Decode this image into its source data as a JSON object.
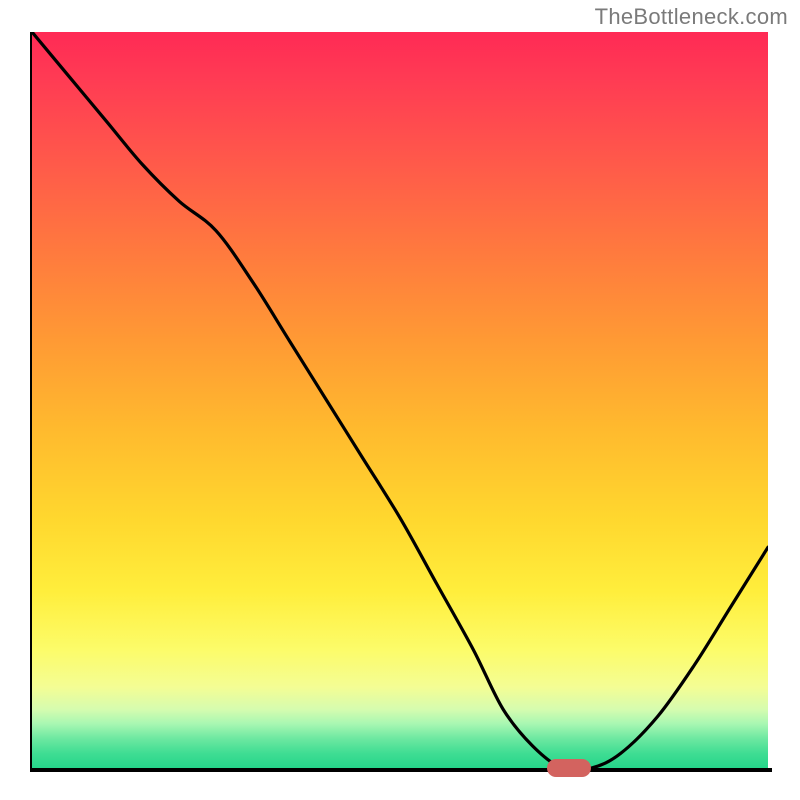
{
  "branding": {
    "watermark": "TheBottleneck.com"
  },
  "chart_data": {
    "type": "line",
    "title": "",
    "xlabel": "",
    "ylabel": "",
    "xlim": [
      0,
      100
    ],
    "ylim": [
      0,
      100
    ],
    "grid": false,
    "legend": false,
    "categories": [
      0,
      5,
      10,
      15,
      20,
      25,
      30,
      35,
      40,
      45,
      50,
      55,
      60,
      64,
      68,
      72,
      76,
      80,
      85,
      90,
      95,
      100
    ],
    "series": [
      {
        "name": "bottleneck-curve",
        "values": [
          100,
          94,
          88,
          82,
          77,
          73,
          66,
          58,
          50,
          42,
          34,
          25,
          16,
          8,
          3,
          0,
          0,
          2,
          7,
          14,
          22,
          30
        ]
      }
    ],
    "marker": {
      "x": 73,
      "y": 0,
      "color": "#d3635f"
    },
    "gradient_colors": {
      "top": "#ff2a55",
      "middle": "#ffd72e",
      "bottom": "#26d58a"
    }
  }
}
